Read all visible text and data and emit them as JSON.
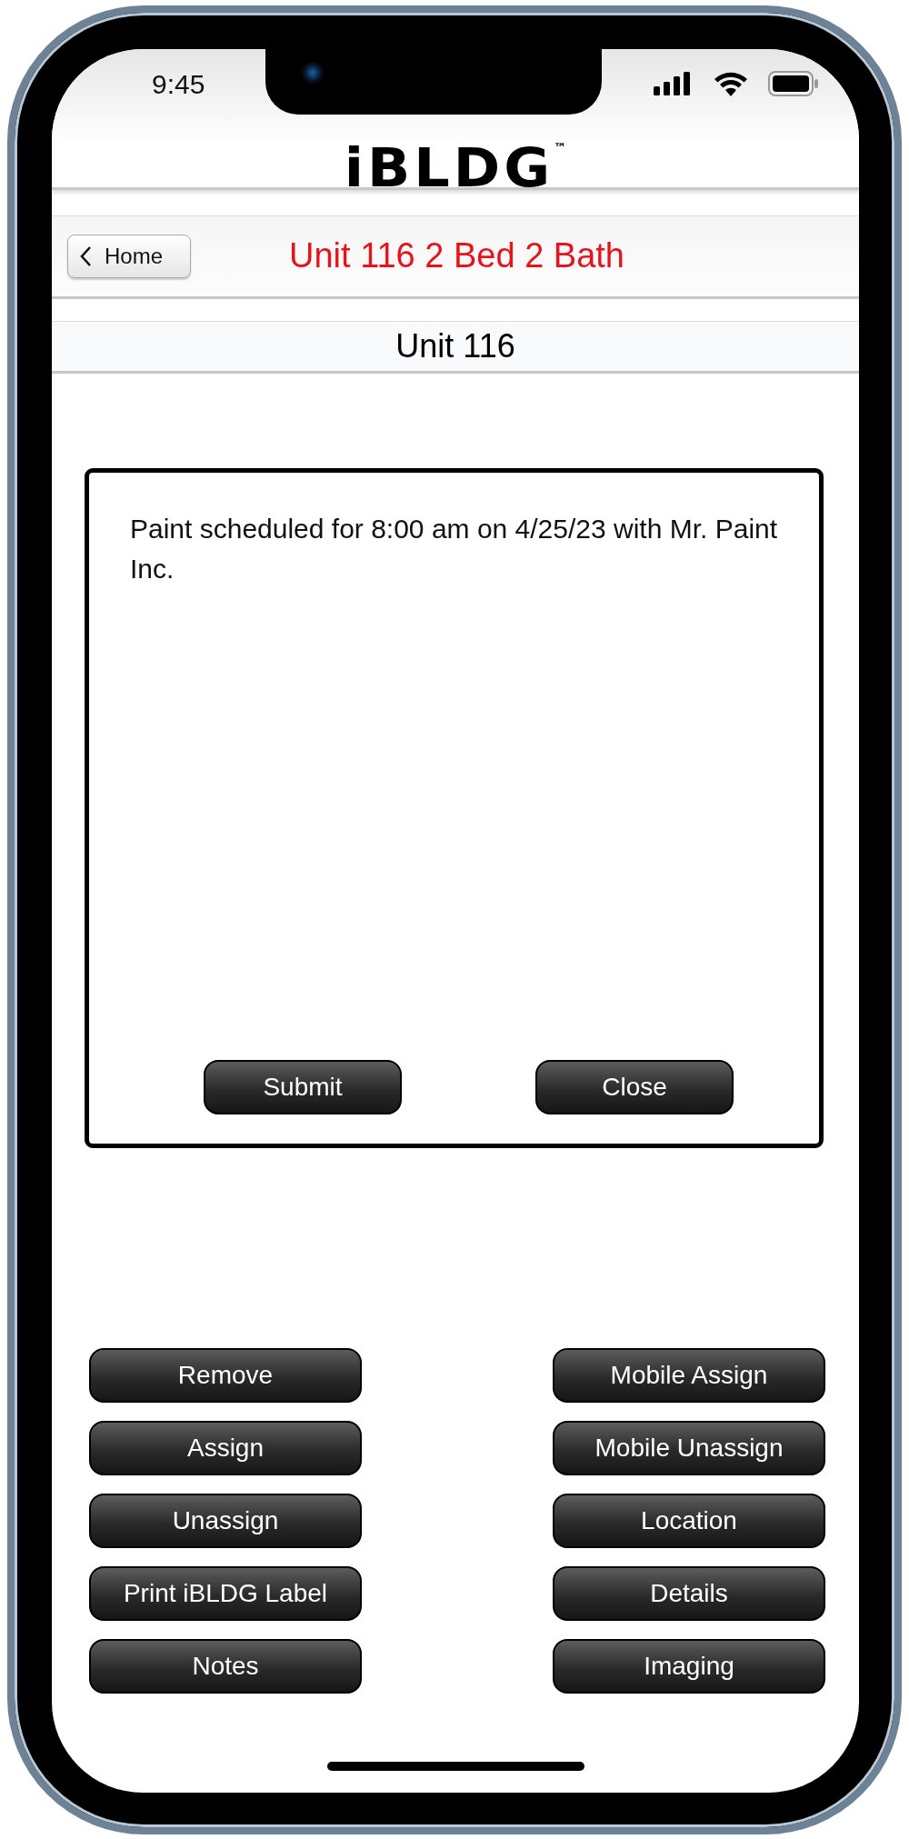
{
  "status_bar": {
    "time": "9:45"
  },
  "logo": "iBLDG$^{™}$",
  "nav": {
    "back_button": "Home",
    "title": "Unit 116 2 Bed 2 Bath"
  },
  "subtitle": "Unit 116",
  "dialog": {
    "message": "Paint scheduled for 8:00 am on 4/25/23 with Mr. Paint Inc.",
    "buttons": [
      "Submit",
      "Close"
    ]
  },
  "actions": {
    "left": [
      "Remove",
      "Assign",
      "Unassign",
      "Print iBLDG Label",
      "Notes"
    ],
    "right": [
      "Mobile Assign",
      "Mobile Unassign",
      "Location",
      "Details",
      "Imaging"
    ]
  }
}
